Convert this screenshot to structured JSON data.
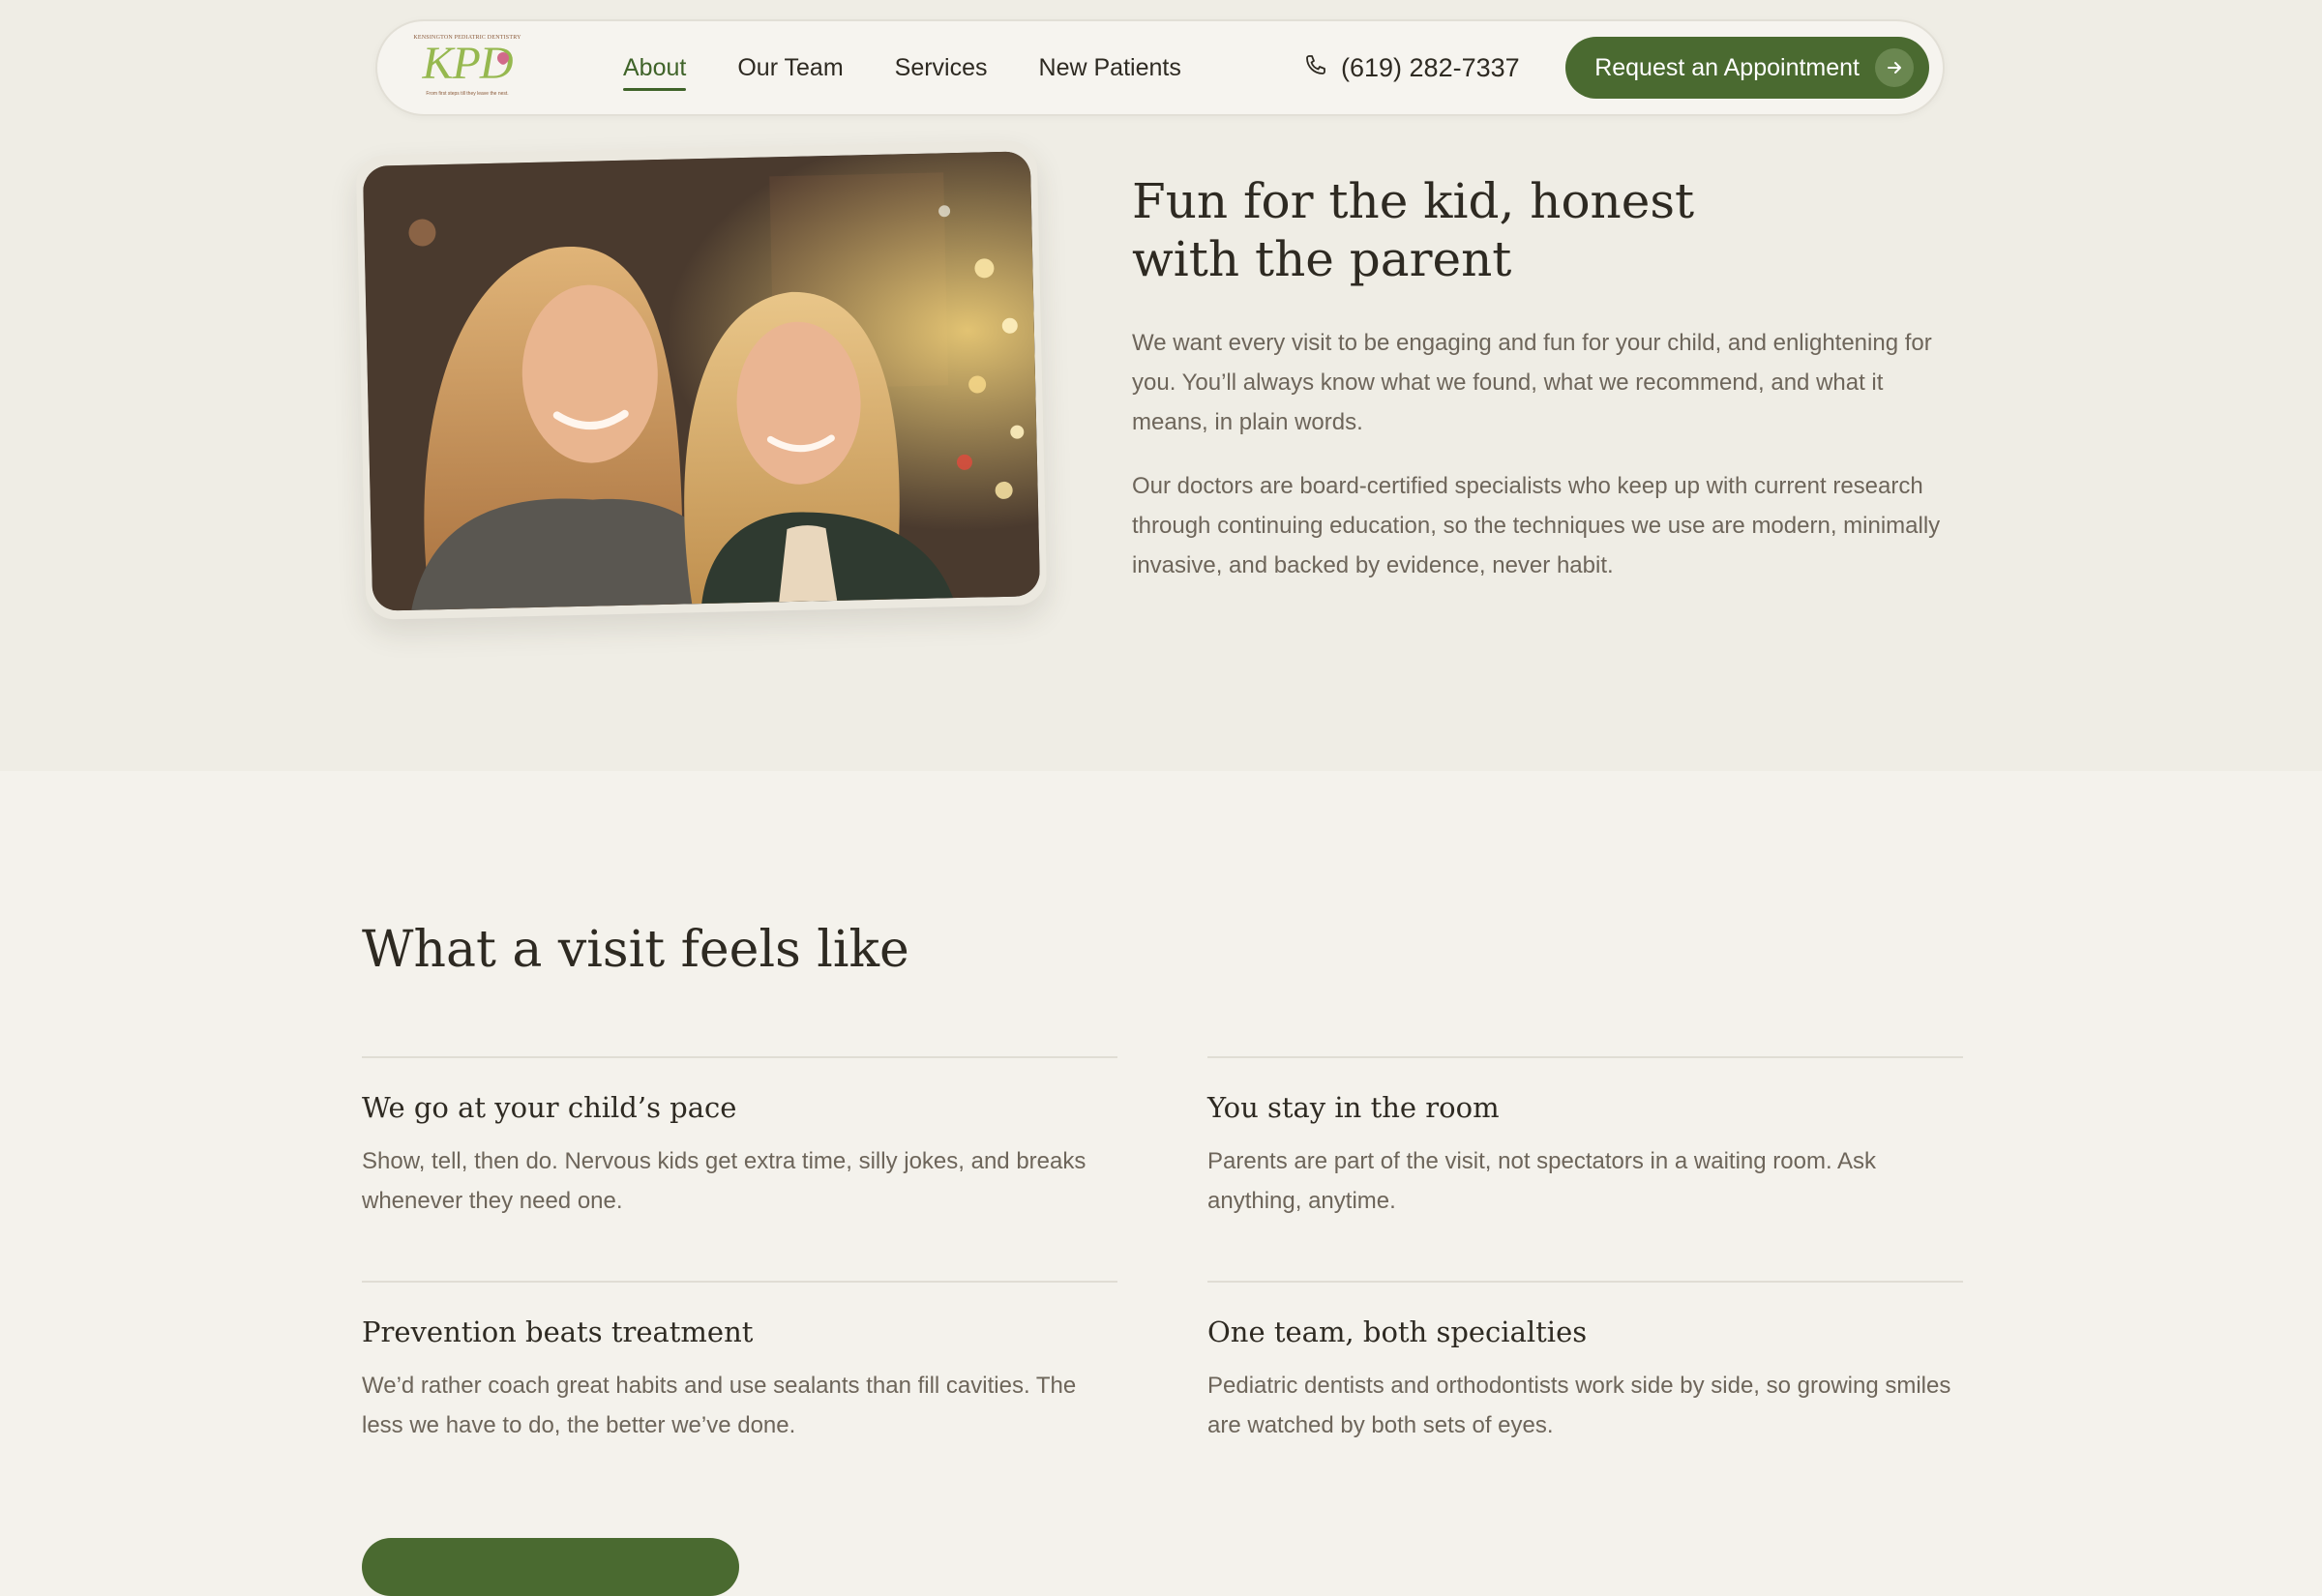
{
  "nav": {
    "logo_top": "KENSINGTON PEDIATRIC DENTISTRY",
    "logo_mark": "KPD",
    "logo_tagline": "From first steps till they leave the nest.",
    "links": [
      "About",
      "Our Team",
      "Services",
      "New Patients"
    ],
    "active_link": "About",
    "phone": "(619) 282-7337",
    "cta_label": "Request an Appointment"
  },
  "hero": {
    "title_line1": "Fun for the kid, honest",
    "title_line2": "with the parent",
    "paragraphs": [
      "We want every visit to be engaging and fun for your child, and enlightening for you. You’ll always know what we found, what we recommend, and what it means, in plain words.",
      "Our doctors are board-certified specialists who keep up with current research through continuing education, so the techniques we use are modern, minimally invasive, and backed by evidence, never habit."
    ]
  },
  "visit": {
    "title": "What a visit feels like",
    "features": [
      {
        "title": "We go at your child’s pace",
        "text": "Show, tell, then do. Nervous kids get extra time, silly jokes, and breaks whenever they need one."
      },
      {
        "title": "You stay in the room",
        "text": "Parents are part of the visit, not spectators in a waiting room. Ask anything, anytime."
      },
      {
        "title": "Prevention beats treatment",
        "text": "We’d rather coach great habits and use sealants than fill cavities. The less we have to do, the better we’ve done."
      },
      {
        "title": "One team, both specialties",
        "text": "Pediatric dentists and orthodontists work side by side, so growing smiles are watched by both sets of eyes."
      }
    ]
  },
  "colors": {
    "accent": "#4a6a30",
    "accent_text": "#3f6329",
    "logo_green": "#96b84f",
    "top_band": "#efede5",
    "background": "#f4f2ec",
    "body_text": "#6d655a",
    "heading_text": "#2e2a22"
  },
  "icons": {
    "phone": "phone-icon",
    "cta_arrow": "arrow-right-icon"
  }
}
